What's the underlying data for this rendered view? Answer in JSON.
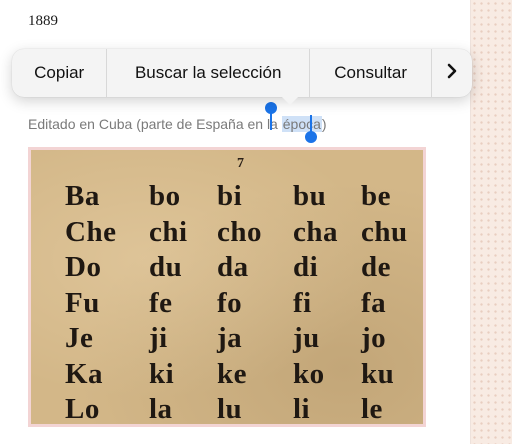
{
  "document": {
    "year": "1889",
    "caption_before": "Editado en Cuba (parte de España en la ",
    "caption_selected": "época",
    "caption_after": ")"
  },
  "context_menu": {
    "copy_label": "Copiar",
    "search_label": "Buscar la selección",
    "consult_label": "Consultar",
    "more_icon": "chevron-right-icon",
    "more_glyph": "›"
  },
  "figure": {
    "page_number": "7",
    "rows": [
      [
        "Ba",
        "bo",
        "bi",
        "bu",
        "be"
      ],
      [
        "Che",
        "chi",
        "cho",
        "cha",
        "chu"
      ],
      [
        "Do",
        "du",
        "da",
        "di",
        "de"
      ],
      [
        "Fu",
        "fe",
        "fo",
        "fi",
        "fa"
      ],
      [
        "Je",
        "ji",
        "ja",
        "ju",
        "jo"
      ],
      [
        "Ka",
        "ki",
        "ke",
        "ko",
        "ku"
      ],
      [
        "Lo",
        "la",
        "lu",
        "li",
        "le"
      ]
    ]
  },
  "colors": {
    "selection_handle": "#1a73e8",
    "selection_highlight": "#cfe1f7",
    "paper": "#d3b788"
  }
}
